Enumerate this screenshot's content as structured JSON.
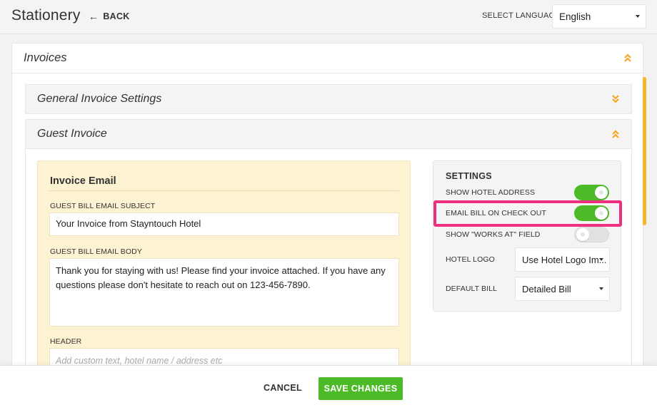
{
  "header": {
    "app_title": "Stationery",
    "back_label": "BACK",
    "language_label": "SELECT LANGUAGE",
    "language_value": "English"
  },
  "invoices_panel": {
    "title": "Invoices",
    "general_settings_title": "General Invoice Settings",
    "guest_invoice_title": "Guest Invoice"
  },
  "invoice_email": {
    "title": "Invoice Email",
    "subject_label": "GUEST BILL EMAIL SUBJECT",
    "subject_value": "Your Invoice from Stayntouch Hotel",
    "body_label": "GUEST BILL EMAIL BODY",
    "body_value": "Thank you for staying with us! Please find your invoice attached. If you have any questions please don't hesitate to reach out on 123-456-7890.",
    "header_label": "HEADER",
    "header_placeholder": "Add custom text, hotel name / address etc"
  },
  "settings": {
    "title": "SETTINGS",
    "show_hotel_address_label": "SHOW HOTEL ADDRESS",
    "show_hotel_address_on": true,
    "email_bill_label": "EMAIL BILL ON CHECK OUT",
    "email_bill_on": true,
    "works_at_label": "SHOW \"WORKS AT\" FIELD",
    "works_at_on": false,
    "hotel_logo_label": "HOTEL LOGO",
    "hotel_logo_value": "Use Hotel Logo Im...",
    "default_bill_label": "DEFAULT BILL",
    "default_bill_value": "Detailed Bill"
  },
  "footer": {
    "cancel_label": "CANCEL",
    "save_label": "SAVE CHANGES"
  },
  "colors": {
    "accent_green": "#4cbb27",
    "accent_orange": "#f6a623",
    "highlight_pink": "#ed2f7d",
    "email_card_bg": "#fdf3d2"
  }
}
